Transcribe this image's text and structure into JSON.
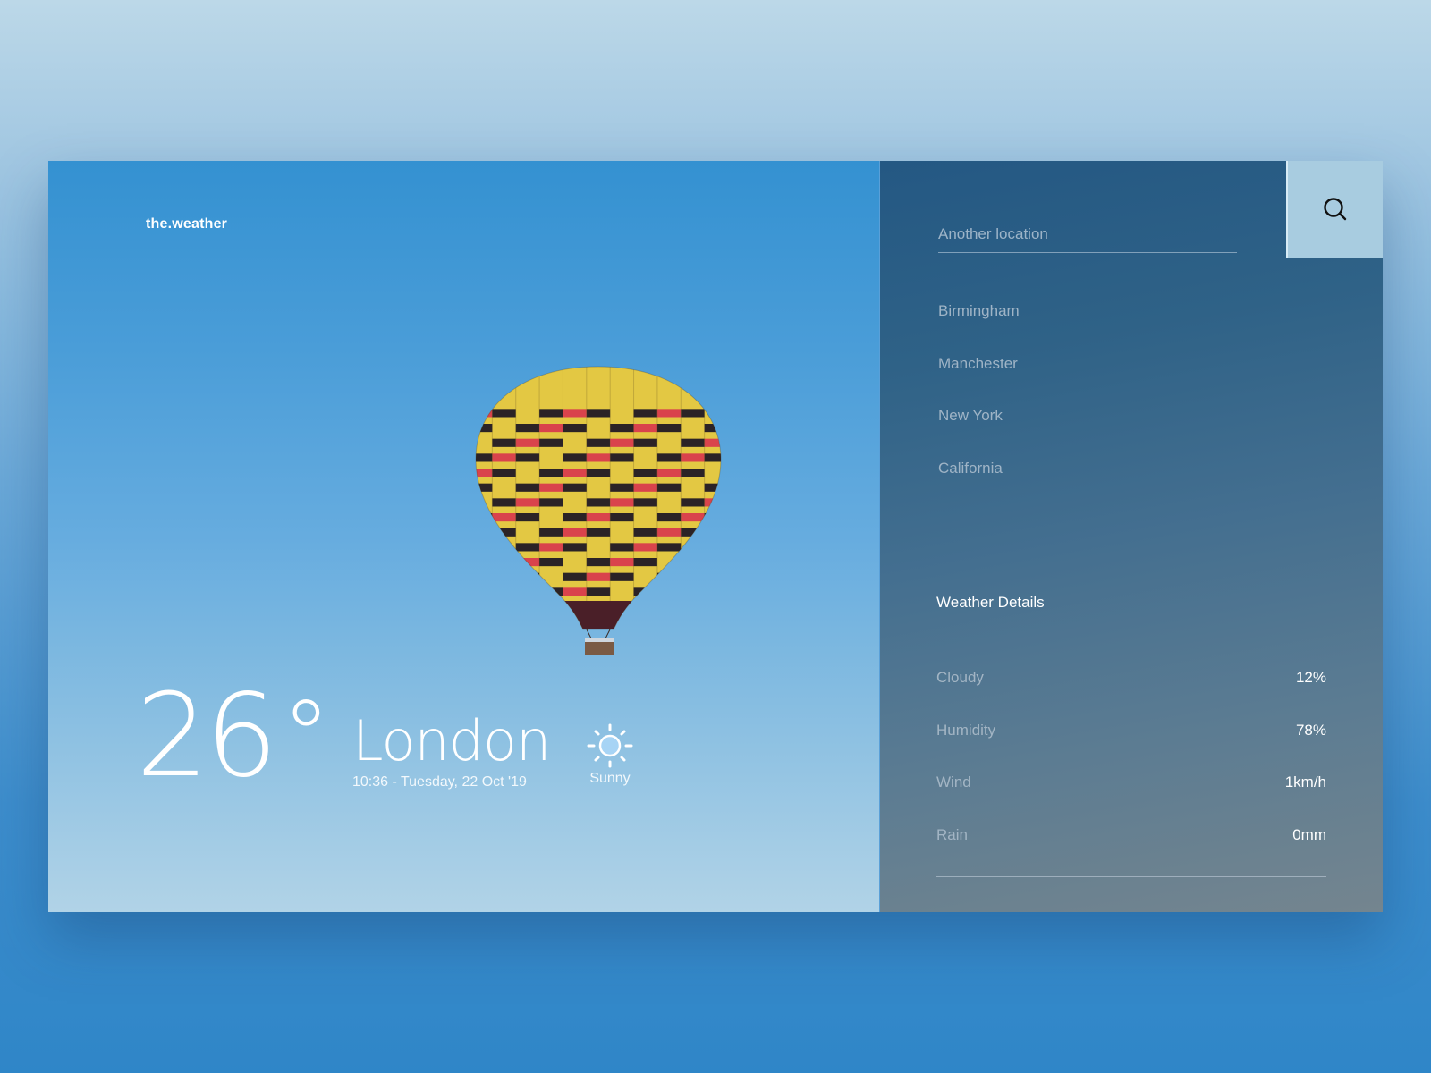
{
  "app": {
    "brand": "the.weather"
  },
  "current": {
    "temperature": "26",
    "degree_symbol": "°",
    "city": "London",
    "datetime": "10:36 - Tuesday, 22 Oct '19",
    "condition": "Sunny",
    "condition_icon": "sun-icon"
  },
  "search": {
    "placeholder": "Another location",
    "value": "",
    "button_icon": "search-icon"
  },
  "locations": [
    "Birmingham",
    "Manchester",
    "New York",
    "California"
  ],
  "details": {
    "title": "Weather Details",
    "rows": [
      {
        "label": "Cloudy",
        "value": "12%"
      },
      {
        "label": "Humidity",
        "value": "78%"
      },
      {
        "label": "Wind",
        "value": "1km/h"
      },
      {
        "label": "Rain",
        "value": "0mm"
      }
    ]
  },
  "colors": {
    "sky_top": "#3491d1",
    "sky_bottom": "#b1d3e7",
    "panel_top": "#245883",
    "panel_bottom": "#74858f",
    "search_button": "#a8cce0",
    "balloon_yellow": "#e3c843",
    "balloon_red": "#d9434c",
    "balloon_dark": "#2b2326"
  }
}
